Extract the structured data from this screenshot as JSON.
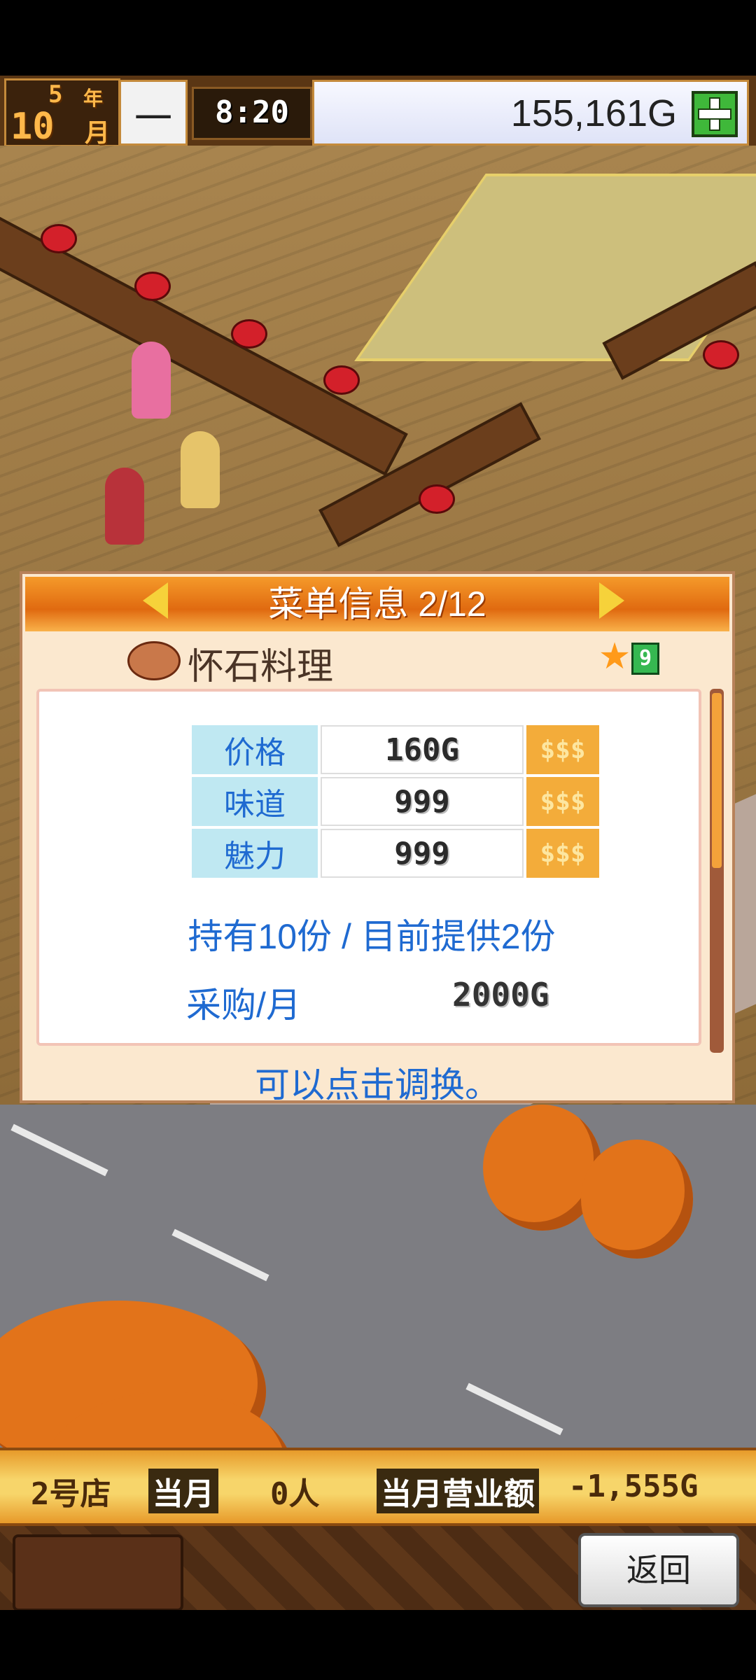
{
  "hud": {
    "year": "5",
    "year_unit": "年",
    "month": "10",
    "month_unit": "月",
    "weekday": "一",
    "time": "8:20",
    "money": "155,161G"
  },
  "menu_panel": {
    "title": "菜单信息 2/12",
    "dish_name": "怀石料理",
    "rank": "9",
    "stats": [
      {
        "label": "价格",
        "value": "160G",
        "upgrade": "$$$"
      },
      {
        "label": "味道",
        "value": "999",
        "upgrade": "$$$"
      },
      {
        "label": "魅力",
        "value": "999",
        "upgrade": "$$$"
      }
    ],
    "stock_line": "持有10份 / 目前提供2份",
    "purchase_label": "采购/月",
    "purchase_value": "2000G",
    "hint": "可以点击调换。"
  },
  "info_bar": {
    "store": "2号店",
    "month_label": "当月",
    "visitors": "0人",
    "revenue_label": "当月营业额",
    "revenue_value": "-1,555G"
  },
  "bottom": {
    "back_label": "返回"
  },
  "colors": {
    "header_orange": "#e06a10",
    "label_blue": "#1f6ad1",
    "label_cell_bg": "#bfe8f2",
    "panel_bg": "#fbe8cf"
  }
}
